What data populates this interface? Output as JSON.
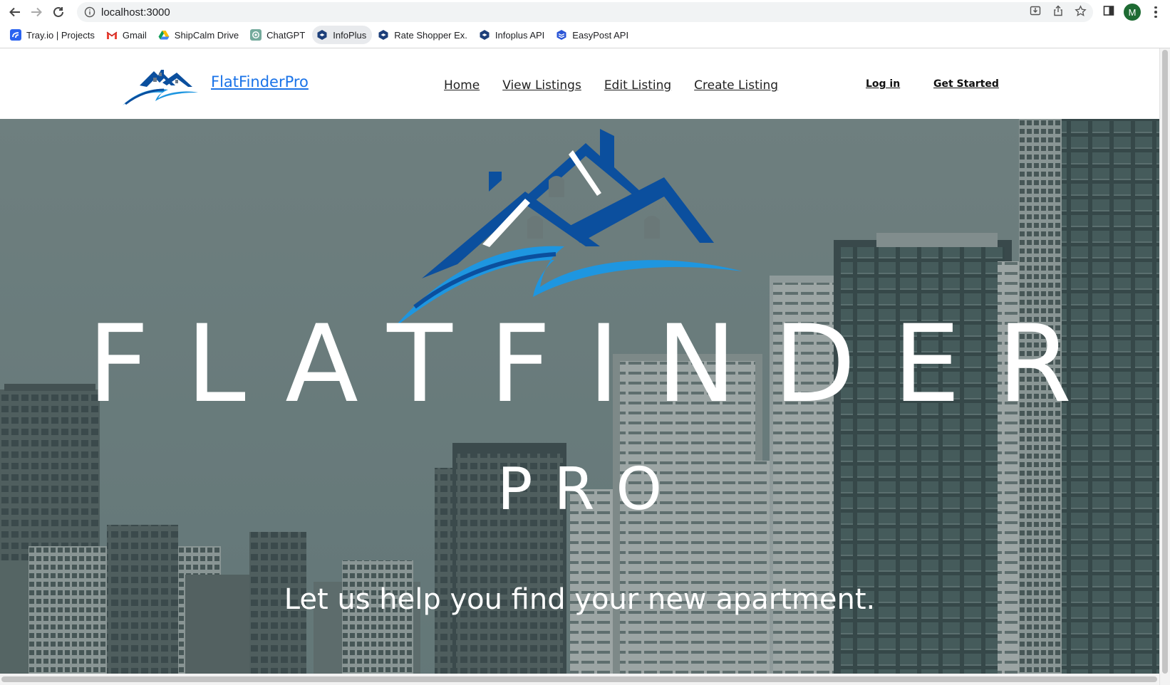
{
  "browser": {
    "url": "localhost:3000",
    "profile_initial": "M",
    "bookmarks": [
      {
        "label": "Tray.io | Projects",
        "icon": "tray-icon"
      },
      {
        "label": "Gmail",
        "icon": "gmail-icon"
      },
      {
        "label": "ShipCalm Drive",
        "icon": "drive-icon"
      },
      {
        "label": "ChatGPT",
        "icon": "chatgpt-icon"
      },
      {
        "label": "InfoPlus",
        "icon": "infoplus-icon"
      },
      {
        "label": "Rate Shopper Ex.",
        "icon": "infoplus-icon"
      },
      {
        "label": "Infoplus API",
        "icon": "infoplus-icon"
      },
      {
        "label": "EasyPost API",
        "icon": "easypost-icon"
      }
    ]
  },
  "site": {
    "brand": "FlatFinderPro",
    "nav": [
      "Home",
      "View Listings",
      "Edit Listing",
      "Create Listing"
    ],
    "login": "Log in",
    "get_started": "Get Started",
    "hero": {
      "title": "FLATFINDER",
      "subtitle": "PRO",
      "tagline": "Let us help you find your new apartment."
    }
  },
  "colors": {
    "brand_dark_blue": "#0b4f9e",
    "brand_light_blue": "#1e96e0",
    "link_blue": "#1a73e8",
    "hero_overlay": "#6b7a7a"
  }
}
